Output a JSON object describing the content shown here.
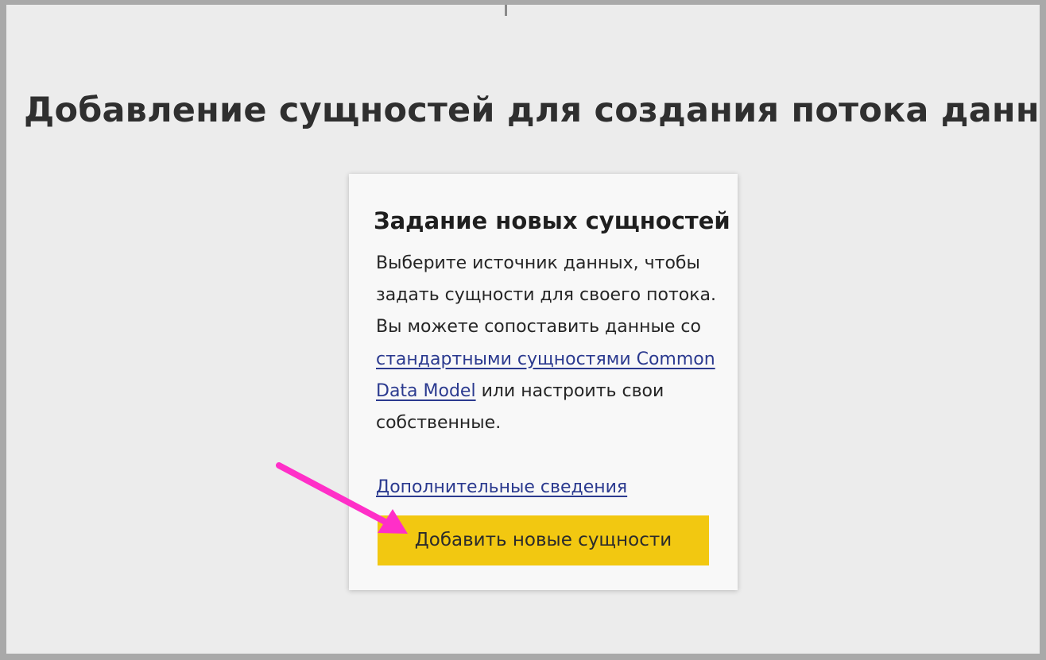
{
  "page": {
    "title": "Добавление сущностей для создания потока данных"
  },
  "card": {
    "title": "Задание новых сущностей",
    "description_before_link": "Выберите источник данных, чтобы задать сущности для своего потока. Вы можете сопоставить данные со ",
    "description_link": "стандартными сущностями Common Data Model",
    "description_after_link": " или настроить свои собственные.",
    "more_link": "Дополнительные сведения",
    "add_button_label": "Добавить новые сущности"
  },
  "annotation": {
    "arrow_icon": "pink-arrow-icon",
    "arrow_color": "#ff2fc8"
  },
  "colors": {
    "page_background": "#ececec",
    "card_background": "#f8f8f8",
    "button_yellow": "#f2c811",
    "link_blue": "#2b3a8f"
  }
}
